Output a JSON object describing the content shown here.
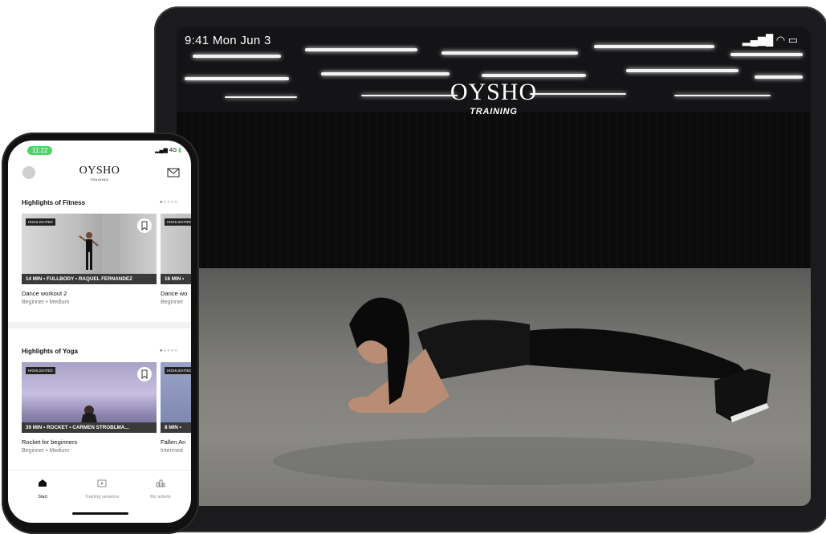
{
  "tablet": {
    "status_time": "9:41 Mon Jun 3",
    "brand": "OYSHO",
    "brand_sub": "TRAINING"
  },
  "phone": {
    "status_time": "11:22",
    "status_network": "4G",
    "brand": "OYSHO",
    "brand_sub": "TRAINING",
    "sections": [
      {
        "title": "Highlights of Fitness",
        "cards": [
          {
            "badge": "HIGHLIGHTED",
            "meta": "14 MIN  •  FULLBODY  •  RAQUEL FERNANDEZ",
            "title": "Dance workout 2",
            "subtitle": "Beginner  •  Medium"
          },
          {
            "badge": "HIGHLIGHTED",
            "meta": "16 MIN  •",
            "title": "Dance wo",
            "subtitle": "Beginner"
          }
        ]
      },
      {
        "title": "Highlights of Yoga",
        "cards": [
          {
            "badge": "HIGHLIGHTED",
            "meta": "39 MIN  •  ROCKET  •  CARMEN STROBLMA...",
            "title": "Rocket for beginners",
            "subtitle": "Beginner  •  Medium"
          },
          {
            "badge": "HIGHLIGHTED",
            "meta": "8 MIN  •",
            "title": "Fallen An",
            "subtitle": "Intermed"
          }
        ]
      }
    ],
    "nav": [
      {
        "label": "Start",
        "icon": "home-icon",
        "active": true
      },
      {
        "label": "Training sessions",
        "icon": "video-icon",
        "active": false
      },
      {
        "label": "My activity",
        "icon": "activity-icon",
        "active": false
      }
    ]
  },
  "colors": {
    "status_pill": "#4cd36a",
    "tablet_bezel": "#1b1b1d",
    "meta_strip": "#3a3a3a"
  }
}
